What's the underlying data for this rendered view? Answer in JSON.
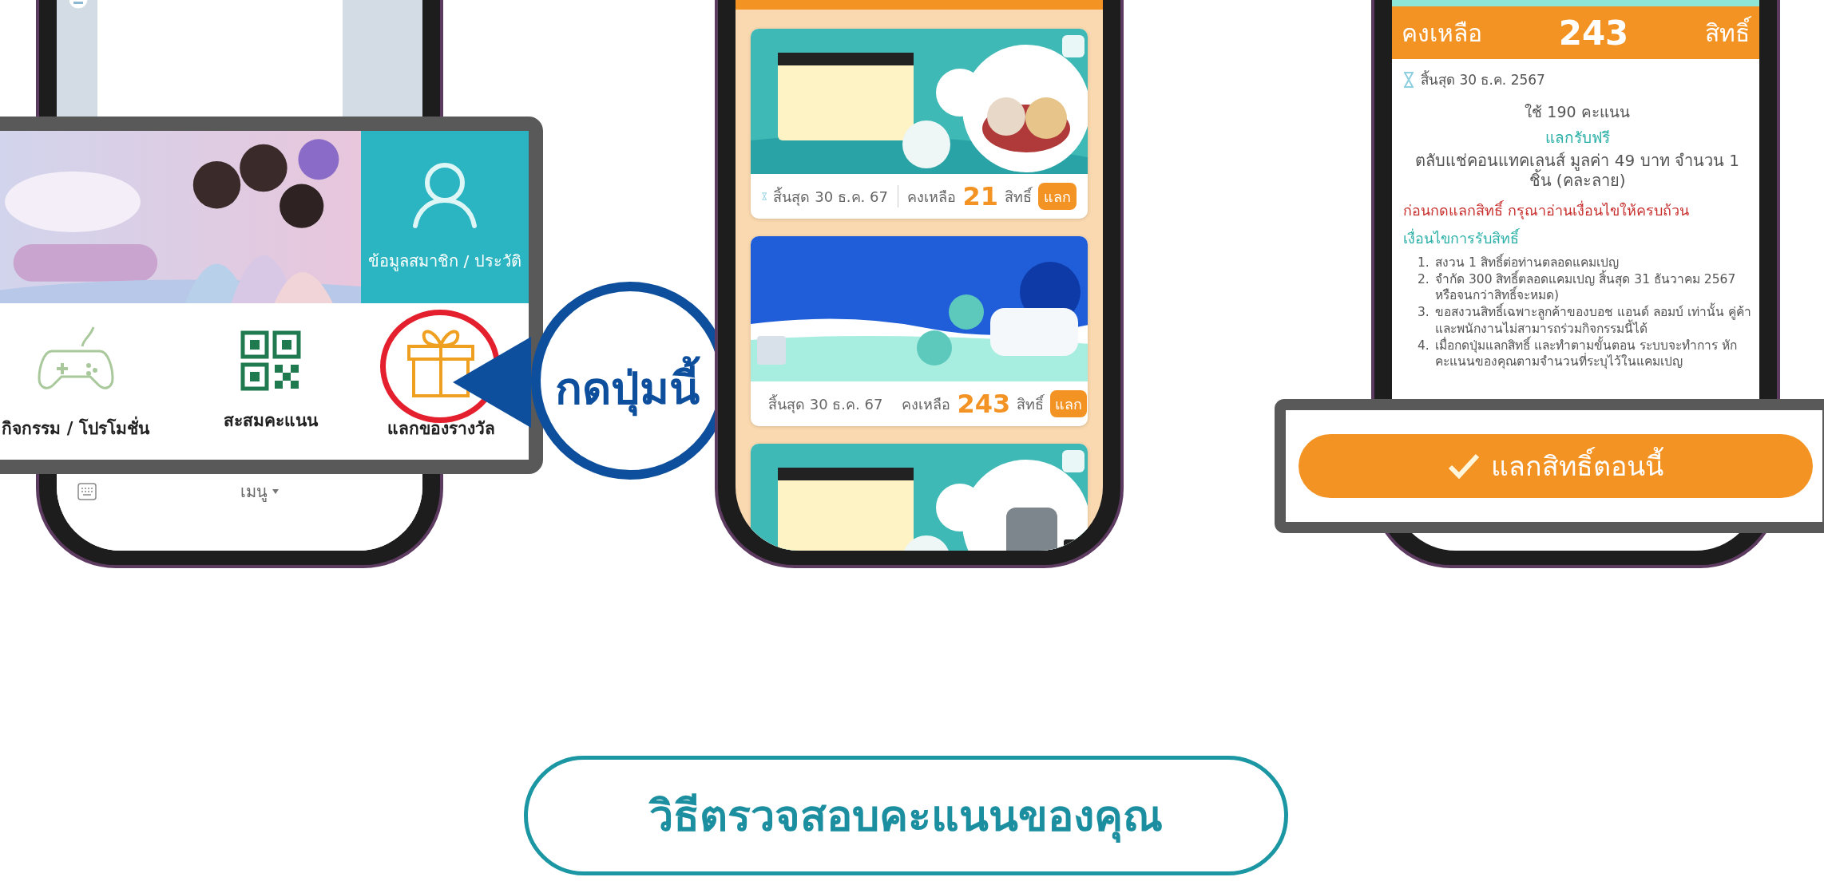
{
  "menu_phone": {
    "tiles": [
      {
        "kind": "picture"
      },
      {
        "kind": "member",
        "label": "ข้อมูลสมาชิก / ประวัติ"
      }
    ],
    "menu_items": [
      {
        "kind": "game",
        "label": "กิจกรรม / โปรโมชั่น",
        "highlighted": false
      },
      {
        "kind": "qr",
        "label": "สะสมคะแนน",
        "highlighted": false
      },
      {
        "kind": "gift",
        "label": "แลกของรางวัล",
        "highlighted": true
      }
    ],
    "callout": "กดปุ่มนี้",
    "bottom_bar": {
      "menu_label": "เมนู"
    }
  },
  "rewards_phone": {
    "cards": [
      {
        "banner": {
          "kind": "picture"
        },
        "footer": {
          "end": "สิ้นสุด 30 ธ.ค. 67",
          "remaining_label": "คงเหลือ",
          "remaining": "21",
          "unit": "สิทธิ์",
          "button": "แลก"
        }
      },
      {
        "banner": {
          "kind": "picture"
        },
        "footer": {
          "end": "สิ้นสุด 30 ธ.ค. 67",
          "remaining_label": "คงเหลือ",
          "remaining": "243",
          "unit": "สิทธิ์",
          "button": "แลก"
        }
      },
      {
        "banner": {
          "kind": "picture"
        }
      }
    ]
  },
  "detail_phone": {
    "header": {
      "label": "คงเหลือ",
      "count": "243",
      "unit": "สิทธิ์"
    },
    "expiry": "สิ้นสุด 30 ธ.ค. 2567",
    "points": "ใช้ 190 คะแนน",
    "offer_title": "แลกรับฟรี",
    "offer": "ตลับแช่คอนแทคเลนส์ มูลค่า 49 บาท จำนวน 1 ชิ้น (คละลาย)",
    "warning": "ก่อนกดแลกสิทธิ์ กรุณาอ่านเงื่อนไขให้ครบถ้วน",
    "conditions_title": "เงื่อนไขการรับสิทธิ์",
    "conditions": [
      {
        "number": "1.",
        "text": "สงวน 1 สิทธิ์ต่อท่านตลอดแคมเปญ"
      },
      {
        "number": "2.",
        "text": "จำกัด 300 สิทธิ์ตลอดแคมเปญ สิ้นสุด 31 ธันวาคม 2567 หรือจนกว่าสิทธิ์จะหมด)"
      },
      {
        "number": "3.",
        "text": "ขอสงวนสิทธิ์เฉพาะลูกค้าของบอช แอนด์ ลอมบ์ เท่านั้น คู่ค้าและพนักงานไม่สามารถร่วมกิจกรรมนี้ได้"
      },
      {
        "number": "4.",
        "text": "เมื่อกดปุ่มแลกสิทธิ์ และทำตามขั้นตอน ระบบจะทำการ หักคะแนนของคุณตามจำนวนที่ระบุไว้ในแคมเปญ"
      }
    ],
    "redeem_button": "แลกสิทธิ์ตอนนี้"
  },
  "footer_button": "วิธีตรวจสอบคะแนนของคุณ"
}
